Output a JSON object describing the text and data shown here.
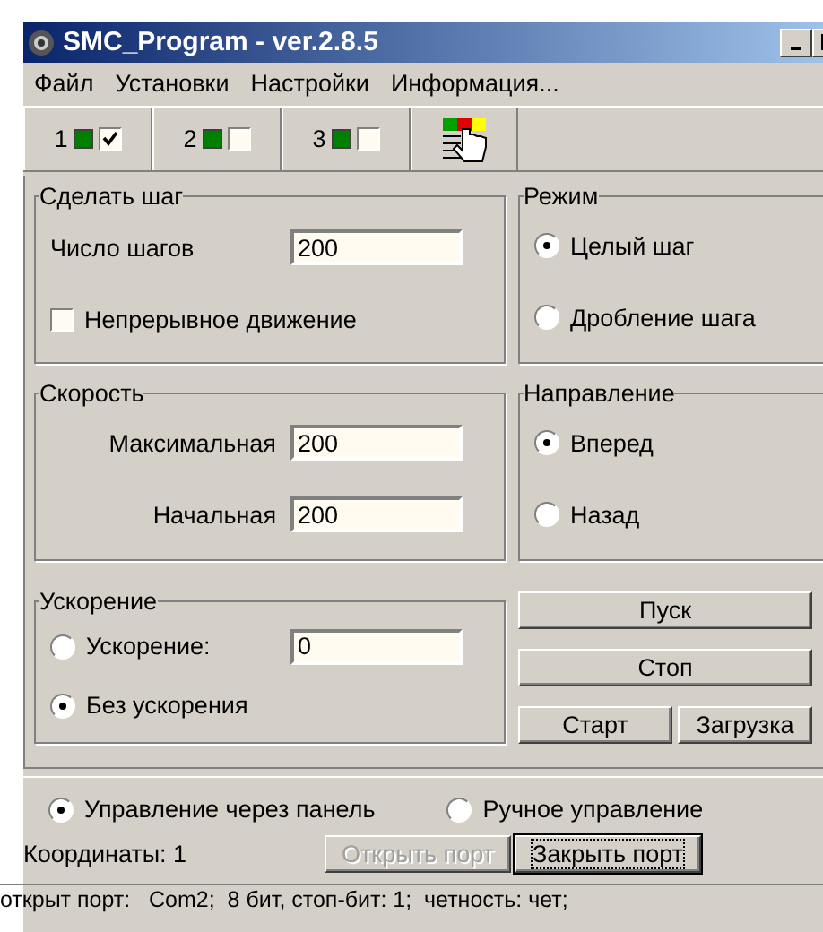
{
  "window": {
    "title": "SMC_Program - ver.2.8.5"
  },
  "menu": [
    "Файл",
    "Установки",
    "Настройки",
    "Информация..."
  ],
  "toolbar": {
    "channels": [
      {
        "label": "1",
        "checked": true
      },
      {
        "label": "2",
        "checked": false
      },
      {
        "label": "3",
        "checked": false
      }
    ]
  },
  "step_group": {
    "title": "Сделать шаг",
    "steps_label": "Число шагов",
    "steps_value": "200",
    "continuous": {
      "label": "Непрерывное движение",
      "checked": false
    }
  },
  "mode_group": {
    "title": "Режим",
    "options": [
      {
        "label": "Целый шаг",
        "selected": true
      },
      {
        "label": "Дробление шага",
        "selected": false
      }
    ]
  },
  "speed_group": {
    "title": "Скорость",
    "fields": [
      {
        "label": "Максимальная",
        "value": "200"
      },
      {
        "label": "Начальная",
        "value": "200"
      }
    ]
  },
  "direction_group": {
    "title": "Направление",
    "options": [
      {
        "label": "Вперед",
        "selected": true
      },
      {
        "label": "Назад",
        "selected": false
      }
    ]
  },
  "accel_group": {
    "title": "Ускорение",
    "value": "0",
    "options": [
      {
        "label": "Ускорение:",
        "selected": false
      },
      {
        "label": "Без ускорения",
        "selected": true
      }
    ]
  },
  "buttons": {
    "start_run": "Пуск",
    "stop": "Стоп",
    "start": "Старт",
    "load": "Загрузка"
  },
  "control_mode": [
    {
      "label": "Управление через панель",
      "selected": true
    },
    {
      "label": "Ручное управление",
      "selected": false
    }
  ],
  "coordinates": "Координаты:  1",
  "port_buttons": [
    {
      "label": "Открыть порт",
      "disabled": true,
      "focused": false
    },
    {
      "label": "Закрыть порт",
      "disabled": false,
      "focused": true
    }
  ],
  "status_bar": "открыт порт:   Com2;  8 бит, стоп-бит: 1;  четность: чет;"
}
